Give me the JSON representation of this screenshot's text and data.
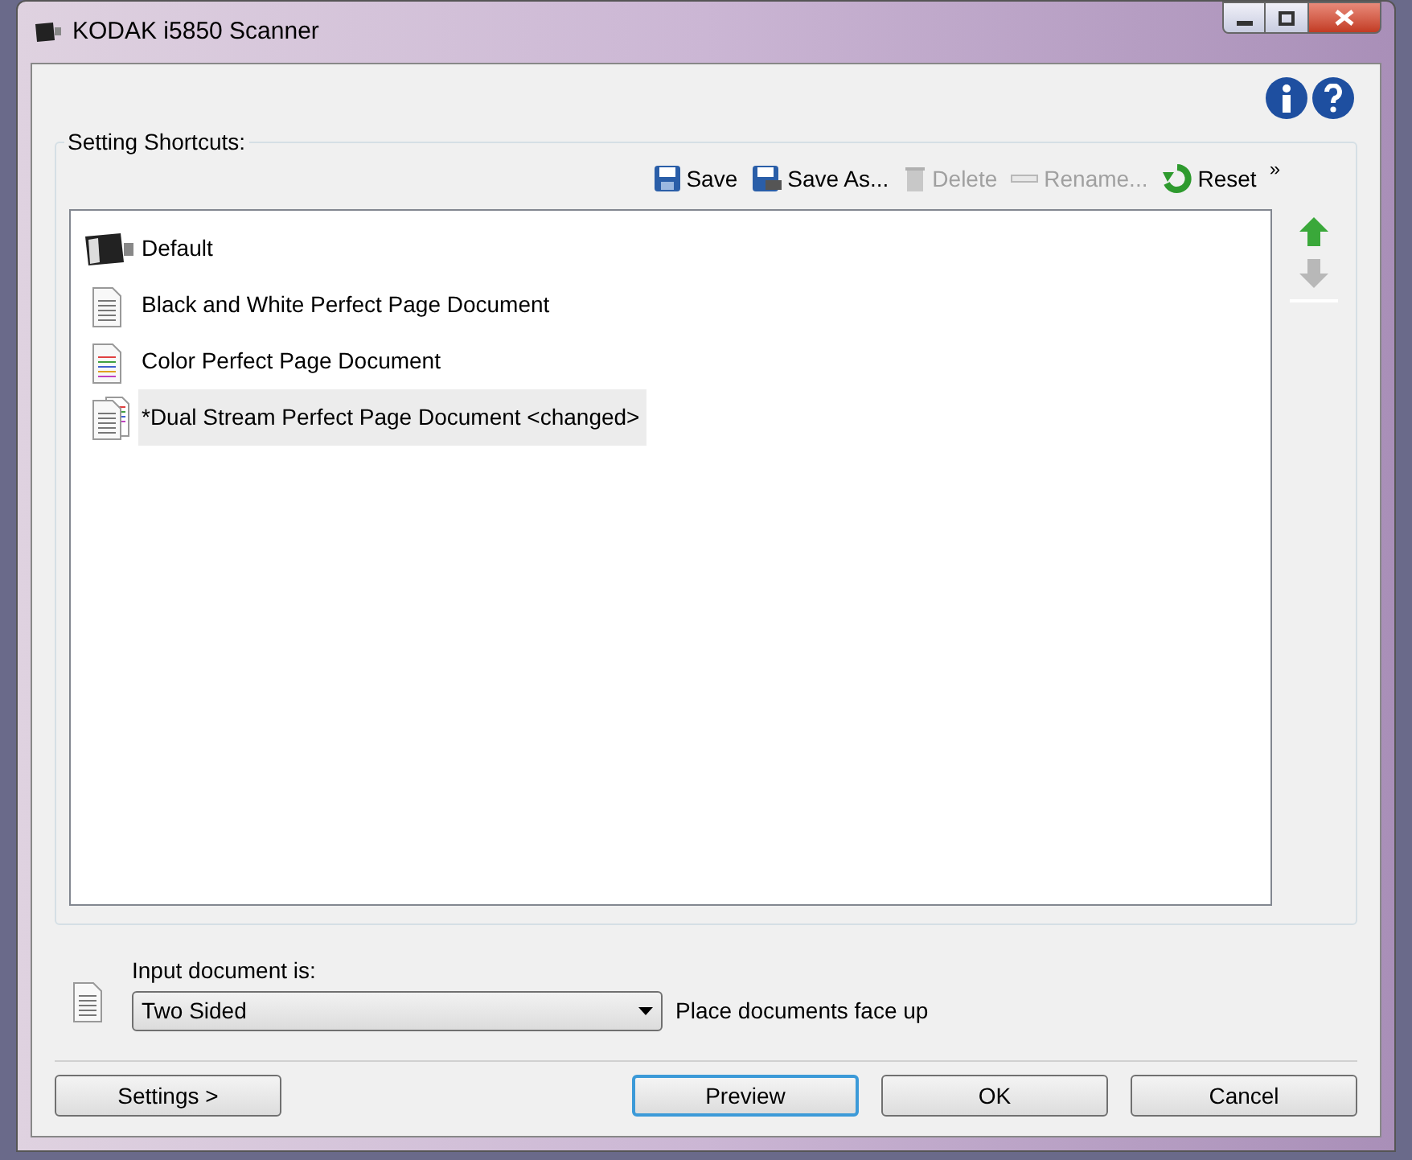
{
  "window": {
    "title": "KODAK i5850 Scanner"
  },
  "shortcuts": {
    "label": "Setting Shortcuts:",
    "toolbar": [
      {
        "kind": "save",
        "label": "Save",
        "disabled": false
      },
      {
        "kind": "save-as",
        "label": "Save As...",
        "disabled": false
      },
      {
        "kind": "delete",
        "label": "Delete",
        "disabled": true
      },
      {
        "kind": "rename",
        "label": "Rename...",
        "disabled": true
      },
      {
        "kind": "reset",
        "label": "Reset",
        "disabled": false
      }
    ],
    "overflow": "»",
    "items": [
      {
        "kind": "scanner",
        "label": "Default",
        "selected": false
      },
      {
        "kind": "mono",
        "label": "Black and White Perfect Page Document",
        "selected": false
      },
      {
        "kind": "color",
        "label": "Color Perfect Page Document",
        "selected": false
      },
      {
        "kind": "dual",
        "label": "*Dual Stream Perfect Page Document <changed>",
        "selected": true
      }
    ],
    "move_up": {
      "disabled": false
    },
    "move_down": {
      "disabled": true
    }
  },
  "input": {
    "label": "Input document is:",
    "value": "Two Sided",
    "hint": "Place documents face up"
  },
  "buttons": [
    {
      "kind": "settings",
      "label": "Settings >"
    },
    {
      "kind": "preview",
      "label": "Preview",
      "focused": true
    },
    {
      "kind": "ok",
      "label": "OK",
      "focused": false
    },
    {
      "kind": "cancel",
      "label": "Cancel",
      "focused": false
    }
  ]
}
